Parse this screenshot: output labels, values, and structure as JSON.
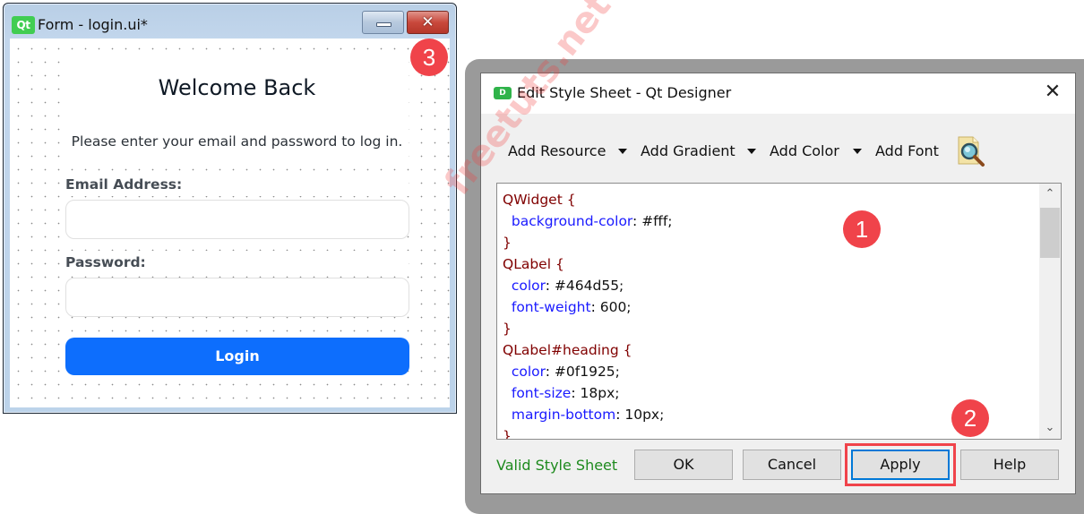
{
  "form_window": {
    "logo_text": "Qt",
    "title": "Form - login.ui*",
    "close_glyph": "✕",
    "heading": "Welcome Back",
    "subtitle": "Please enter your email and password to log in.",
    "email_label": "Email Address:",
    "email_value": "",
    "password_label": "Password:",
    "password_value": "",
    "login_label": "Login"
  },
  "badges": {
    "one": "1",
    "two": "2",
    "three": "3"
  },
  "dialog": {
    "icon_text": "D",
    "title": "Edit Style Sheet - Qt Designer",
    "close_glyph": "✕",
    "toolbar": {
      "add_resource": "Add Resource",
      "add_gradient": "Add Gradient",
      "add_color": "Add Color",
      "add_font": "Add Font"
    },
    "code_lines": [
      {
        "selector": "QWidget {"
      },
      {
        "prop": "background-color",
        "val": "#fff;"
      },
      {
        "brace": "}"
      },
      {
        "selector": "QLabel {"
      },
      {
        "prop": "color",
        "val": "#464d55;"
      },
      {
        "prop": "font-weight",
        "val": "600;"
      },
      {
        "brace": "}"
      },
      {
        "selector": "QLabel#heading {"
      },
      {
        "prop": "color",
        "val": "#0f1925;"
      },
      {
        "prop": "font-size",
        "val": "18px;"
      },
      {
        "prop": "margin-bottom",
        "val": "10px;"
      },
      {
        "brace": "}"
      }
    ],
    "watermark": "freetuts.net",
    "scroll_up_glyph": "⌃",
    "scroll_down_glyph": "⌄",
    "status": "Valid Style Sheet",
    "status_color": "#1e8a1e",
    "buttons": {
      "ok": "OK",
      "cancel": "Cancel",
      "apply": "Apply",
      "help": "Help"
    }
  },
  "colors": {
    "login_button": "#0d6efd",
    "badge": "#f0434a",
    "selector": "#800000",
    "property": "#1a1aff"
  }
}
